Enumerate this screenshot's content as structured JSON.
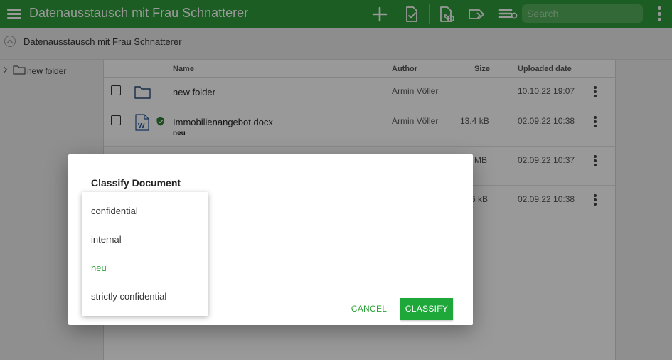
{
  "header": {
    "title": "Datenausstausch mit Frau Schnatterer",
    "search_placeholder": "Search"
  },
  "breadcrumb": {
    "label": "Datenausstausch mit Frau Schnatterer"
  },
  "tree": {
    "items": [
      {
        "label": "new folder",
        "icon": "folder-icon"
      }
    ]
  },
  "table": {
    "columns": {
      "name": "Name",
      "author": "Author",
      "size": "Size",
      "uploaded": "Uploaded date"
    },
    "rows": [
      {
        "name": "new folder",
        "author": "Armin Völler",
        "size": "",
        "date": "10.10.22 19:07",
        "tag": "",
        "type": "folder"
      },
      {
        "name": "Immobilienangebot.docx",
        "author": "Armin Völler",
        "size": "13.4 kB",
        "date": "02.09.22 10:38",
        "tag": "neu",
        "type": "word"
      },
      {
        "name": "",
        "author": "",
        "size": "MB",
        "date": "02.09.22 10:37",
        "tag": "",
        "type": "file"
      },
      {
        "name": "",
        "author": "",
        "size": "6 kB",
        "date": "02.09.22 10:38",
        "tag": "",
        "type": "file"
      }
    ]
  },
  "dialog": {
    "title": "Classify Document",
    "cancel_label": "CANCEL",
    "classify_label": "CLASSIFY",
    "options": [
      {
        "label": "confidential",
        "selected": false
      },
      {
        "label": "internal",
        "selected": false
      },
      {
        "label": "neu",
        "selected": true
      },
      {
        "label": "strictly confidential",
        "selected": false
      }
    ]
  },
  "colors": {
    "brand_green": "#2e9c3b",
    "button_green": "#1fa83a",
    "selected_text": "#2aa135",
    "shield_green": "#2e7d32",
    "word_blue": "#2b579a"
  }
}
